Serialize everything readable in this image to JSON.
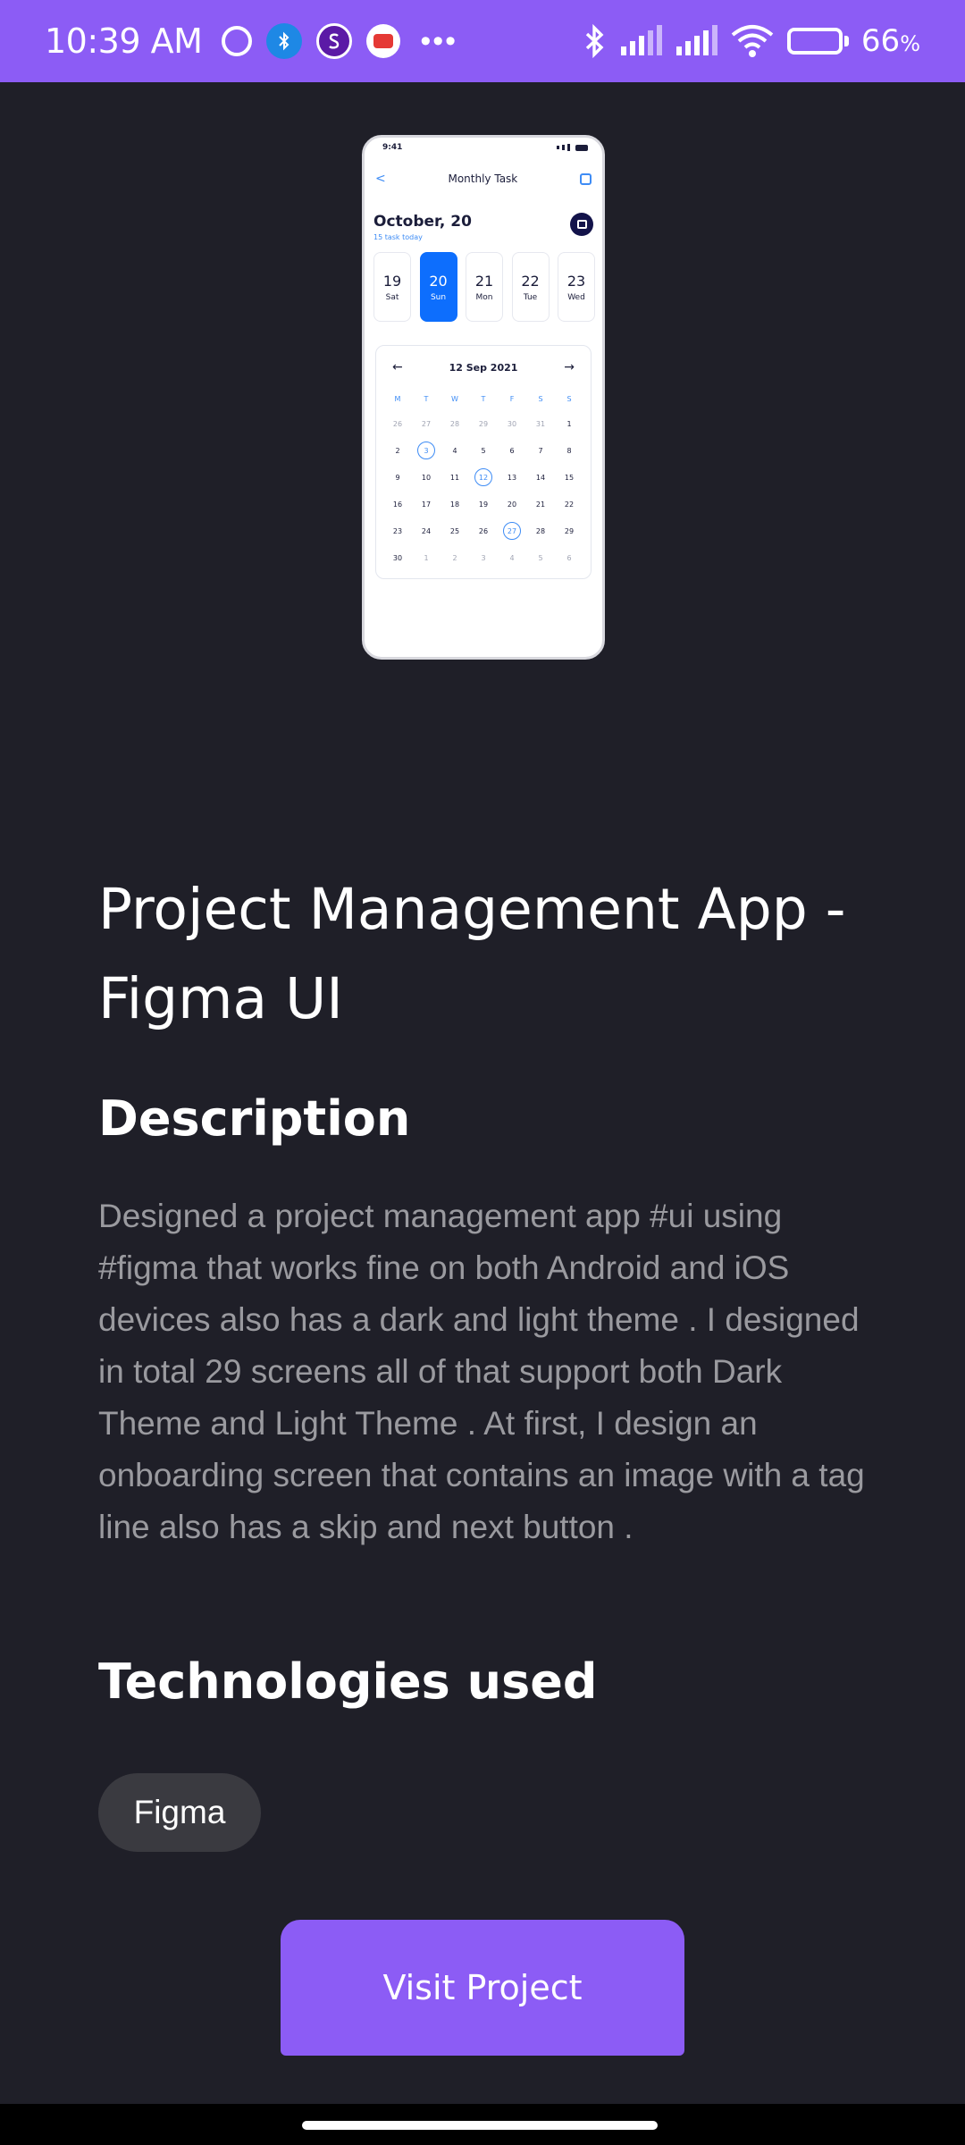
{
  "status_bar": {
    "time": "10:39 AM",
    "battery_percent": "66",
    "battery_unit": "%",
    "battery_level": 0.66,
    "overflow": "•••",
    "icons": [
      "alarm-icon",
      "bluetooth-app-icon",
      "s-app-icon",
      "youtube-icon",
      "bluetooth-icon",
      "signal-icon",
      "signal-icon",
      "wifi-icon",
      "battery-icon"
    ],
    "accent_color": "#8c5cf5"
  },
  "mockup": {
    "time": "9:41",
    "title": "Monthly Task",
    "back": "<",
    "date": "October, 20",
    "subtitle": "15 task today",
    "days": [
      {
        "num": "19",
        "label": "Sat",
        "active": false
      },
      {
        "num": "20",
        "label": "Sun",
        "active": true
      },
      {
        "num": "21",
        "label": "Mon",
        "active": false
      },
      {
        "num": "22",
        "label": "Tue",
        "active": false
      },
      {
        "num": "23",
        "label": "Wed",
        "active": false
      }
    ],
    "calendar": {
      "prev": "←",
      "next": "→",
      "label": "12 Sep 2021",
      "weekdays": [
        "M",
        "T",
        "W",
        "T",
        "F",
        "S",
        "S"
      ],
      "cells": [
        {
          "d": "26",
          "muted": true
        },
        {
          "d": "27",
          "muted": true
        },
        {
          "d": "28",
          "muted": true
        },
        {
          "d": "29",
          "muted": true
        },
        {
          "d": "30",
          "muted": true
        },
        {
          "d": "31",
          "muted": true
        },
        {
          "d": "1"
        },
        {
          "d": "2"
        },
        {
          "d": "3",
          "ring": true
        },
        {
          "d": "4"
        },
        {
          "d": "5"
        },
        {
          "d": "6"
        },
        {
          "d": "7"
        },
        {
          "d": "8"
        },
        {
          "d": "9"
        },
        {
          "d": "10"
        },
        {
          "d": "11"
        },
        {
          "d": "12",
          "ring": true
        },
        {
          "d": "13"
        },
        {
          "d": "14"
        },
        {
          "d": "15"
        },
        {
          "d": "16"
        },
        {
          "d": "17"
        },
        {
          "d": "18"
        },
        {
          "d": "19"
        },
        {
          "d": "20"
        },
        {
          "d": "21"
        },
        {
          "d": "22"
        },
        {
          "d": "23"
        },
        {
          "d": "24"
        },
        {
          "d": "25"
        },
        {
          "d": "26"
        },
        {
          "d": "27",
          "ring": true
        },
        {
          "d": "28"
        },
        {
          "d": "29"
        },
        {
          "d": "30"
        },
        {
          "d": "1",
          "muted": true
        },
        {
          "d": "2",
          "muted": true
        },
        {
          "d": "3",
          "muted": true
        },
        {
          "d": "4",
          "muted": true
        },
        {
          "d": "5",
          "muted": true
        },
        {
          "d": "6",
          "muted": true
        }
      ]
    },
    "accent_color": "#0d6efd"
  },
  "project": {
    "title": "Project Management App - Figma UI",
    "description_heading": "Description",
    "description": "Designed a project management app #ui using #figma that works fine on both Android and iOS devices also has a dark and light theme . I designed in total 29 screens all of that support both Dark Theme and Light Theme . At first, I design an onboarding screen that contains an image with a tag line also has a skip and next button .",
    "technologies_heading": "Technologies used",
    "technologies": [
      "Figma"
    ],
    "visit_label": "Visit Project"
  },
  "colors": {
    "background": "#1f1f28",
    "accent": "#8c5cf5",
    "chip": "#3a3a40",
    "muted_text": "#9a9a9f"
  }
}
